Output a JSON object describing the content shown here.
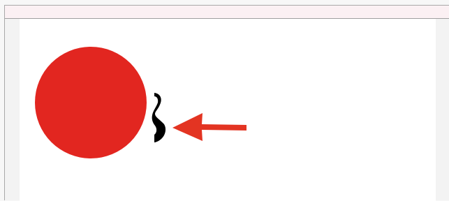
{
  "window": {
    "title": ""
  },
  "canvas": {
    "shapes": [
      {
        "type": "circle",
        "name": "red-circle",
        "color": "#e22620"
      },
      {
        "type": "glyph",
        "name": "black-brace-shape",
        "color": "#000000"
      },
      {
        "type": "arrow",
        "name": "red-arrow",
        "color": "#e33422"
      }
    ]
  }
}
